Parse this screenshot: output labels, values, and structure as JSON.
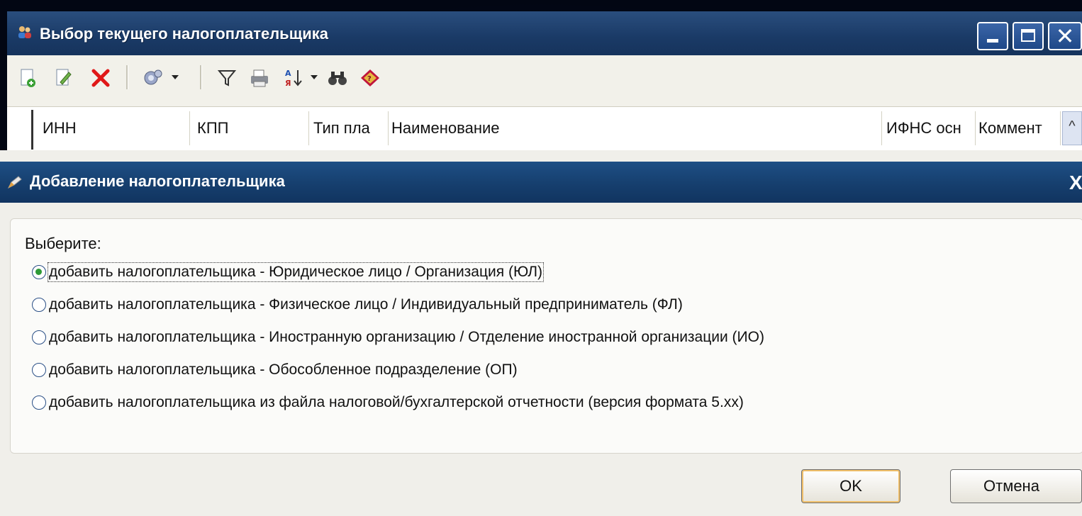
{
  "outer_window": {
    "title": "Выбор текущего налогоплательщика",
    "icon": "users-icon"
  },
  "toolbar": {
    "icons": [
      "add-record-icon",
      "edit-record-icon",
      "delete-icon",
      "settings-icon",
      "filter-icon",
      "print-icon",
      "sort-icon",
      "find-icon",
      "help-icon"
    ]
  },
  "grid": {
    "columns": [
      "ИНН",
      "КПП",
      "Тип пла",
      "Наименование",
      "ИФНС осн",
      "Коммент"
    ]
  },
  "dialog": {
    "title": "Добавление налогоплательщика",
    "close_label": "X",
    "choose_label": "Выберите:",
    "options": [
      {
        "label": "добавить налогоплательщика - Юридическое лицо / Организация (ЮЛ)",
        "checked": true
      },
      {
        "label": "добавить налогоплательщика - Физическое лицо / Индивидуальный предприниматель (ФЛ)",
        "checked": false
      },
      {
        "label": "добавить налогоплательщика - Иностранную организацию / Отделение иностранной организации (ИО)",
        "checked": false
      },
      {
        "label": "добавить налогоплательщика - Обособленное подразделение (ОП)",
        "checked": false
      },
      {
        "label": "добавить налогоплательщика из файла налоговой/бухгалтерской отчетности (версия формата 5.xx)",
        "checked": false
      }
    ],
    "ok_label": "OK",
    "cancel_label": "Отмена"
  }
}
